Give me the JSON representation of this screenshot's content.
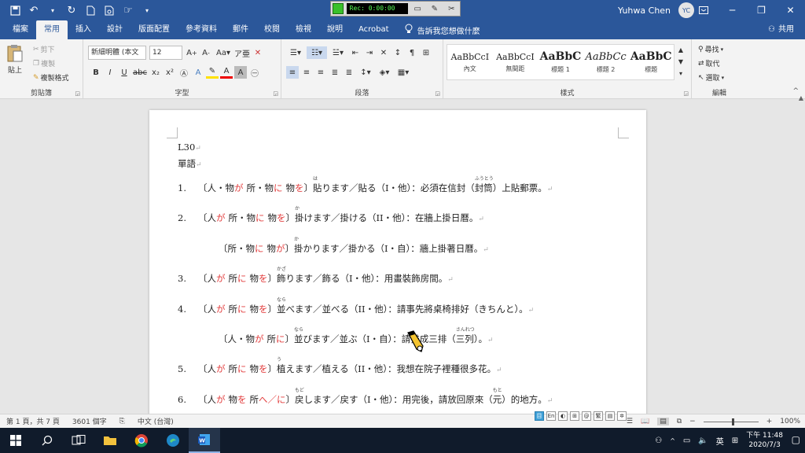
{
  "titlebar": {
    "user_name": "Yuhwa Chen",
    "user_initials": "YC",
    "recorder_time": "Rec: 0:00:00"
  },
  "tabs": [
    "檔案",
    "常用",
    "插入",
    "設計",
    "版面配置",
    "參考資料",
    "郵件",
    "校閱",
    "檢視",
    "說明",
    "Acrobat"
  ],
  "tell_me": "告訴我您想做什麼",
  "share": "共用",
  "ribbon": {
    "clipboard": {
      "label": "剪貼簿",
      "paste": "貼上",
      "cut": "剪下",
      "copy": "複製",
      "format_painter": "複製格式"
    },
    "font": {
      "label": "字型",
      "name": "新細明體 (本文",
      "size": "12"
    },
    "paragraph": {
      "label": "段落"
    },
    "styles": {
      "label": "樣式",
      "items": [
        {
          "preview": "AaBbCcI",
          "name": "內文"
        },
        {
          "preview": "AaBbCcI",
          "name": "無間距"
        },
        {
          "preview": "AaBbC",
          "name": "標題 1"
        },
        {
          "preview": "AaBbCc",
          "name": "標題 2"
        },
        {
          "preview": "AaBbC",
          "name": "標題"
        }
      ]
    },
    "editing": {
      "label": "編輯",
      "find": "尋找",
      "replace": "取代",
      "select": "選取"
    }
  },
  "document": {
    "heading1": "L30",
    "heading2": "單語",
    "items": [
      {
        "num": "1.",
        "open": "〔人・物",
        "p1": "が",
        "mid1": "所・物",
        "p2": "に",
        "mid2": "物",
        "p3": "を",
        "close": "〕",
        "head": "貼",
        "ruby": "は",
        "rest": "ります／貼る（I・他）：必須在信封（",
        "word2": "封筒",
        "ruby2": "ふうとう",
        "tail": "）上貼郵票。"
      },
      {
        "num": "2.",
        "open": "〔人",
        "p1": "が",
        "mid1": "所・物",
        "p2": "に",
        "mid2": "物",
        "p3": "を",
        "close": "〕",
        "head": "掛",
        "ruby": "か",
        "rest": "けます／掛ける（II・他）：在牆上掛日曆。",
        "word2": "",
        "ruby2": "",
        "tail": ""
      },
      {
        "num": "",
        "open": "〔所・物",
        "p1": "に",
        "mid1": "物",
        "p2": "が",
        "mid2": "",
        "p3": "",
        "close": "〕",
        "head": "掛",
        "ruby": "か",
        "rest": "かります／掛かる（I・自）：牆上掛著日曆。",
        "word2": "",
        "ruby2": "",
        "tail": ""
      },
      {
        "num": "3.",
        "open": "〔人",
        "p1": "が",
        "mid1": "所",
        "p2": "に",
        "mid2": "物",
        "p3": "を",
        "close": "〕",
        "head": "飾",
        "ruby": "かざ",
        "rest": "ります／飾る（I・他）：用畫裝飾房間。",
        "word2": "",
        "ruby2": "",
        "tail": ""
      },
      {
        "num": "4.",
        "open": "〔人",
        "p1": "が",
        "mid1": "所",
        "p2": "に",
        "mid2": "物",
        "p3": "を",
        "close": "〕",
        "head": "並",
        "ruby": "なら",
        "rest": "べます／並べる（II・他）：請事先將桌椅排好（きちんと）。",
        "word2": "",
        "ruby2": "",
        "tail": ""
      },
      {
        "num": "",
        "open": "〔人・物",
        "p1": "が",
        "mid1": "所",
        "p2": "に",
        "mid2": "",
        "p3": "",
        "close": "〕",
        "head": "並",
        "ruby": "なら",
        "rest": "びます／並ぶ（I・自）：請排成三排（",
        "word2": "三列",
        "ruby2": "さんれつ",
        "tail": "）。"
      },
      {
        "num": "5.",
        "open": "〔人",
        "p1": "が",
        "mid1": "所",
        "p2": "に",
        "mid2": "物",
        "p3": "を",
        "close": "〕",
        "head": "植",
        "ruby": "う",
        "rest": "えます／植える（II・他）：我想在院子裡種很多花。",
        "word2": "",
        "ruby2": "",
        "tail": ""
      },
      {
        "num": "6.",
        "open": "〔人",
        "p1": "が",
        "mid1": "物",
        "p2": "を",
        "mid2": "所",
        "p3": "へ／に",
        "close": "〕",
        "head": "戻",
        "ruby": "もど",
        "rest": "します／戻す（I・他）：用完後，請放回原來（",
        "word2": "元",
        "ruby2": "もと",
        "tail": "）的地方。"
      }
    ]
  },
  "statusbar": {
    "page": "第 1 頁，共 7 頁",
    "words": "3601 個字",
    "language": "中文 (台灣)",
    "zoom": "100%"
  },
  "taskbar": {
    "ime": "英",
    "time": "下午 11:48",
    "date": "2020/7/3"
  }
}
